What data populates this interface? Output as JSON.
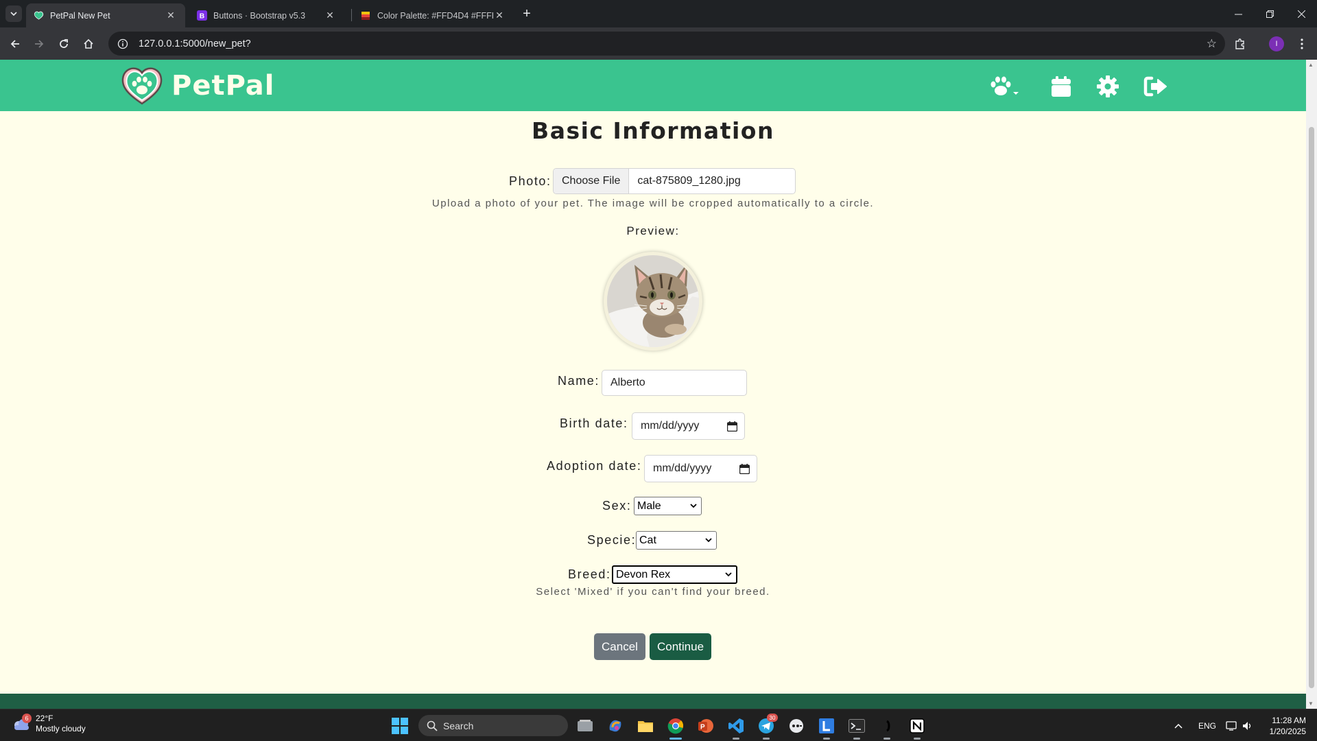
{
  "browser": {
    "tabs": [
      {
        "title": "PetPal New Pet",
        "active": true
      },
      {
        "title": "Buttons · Bootstrap v5.3",
        "active": false
      },
      {
        "title": "Color Palette: #FFD4D4 #FFFFE",
        "active": false
      }
    ],
    "url": "127.0.0.1:5000/new_pet?",
    "profile_initial": "I"
  },
  "navbar": {
    "brand": "PetPal",
    "icons": [
      "paw-menu-icon",
      "calendar-icon",
      "gear-icon",
      "logout-icon"
    ],
    "color": "#3ac48f"
  },
  "form": {
    "heading": "Basic Information",
    "photo": {
      "label": "Photo:",
      "button_label": "Choose File",
      "file_name": "cat-875809_1280.jpg",
      "help": "Upload a photo of your pet. The image will be cropped automatically to a circle."
    },
    "preview_label": "Preview:",
    "name": {
      "label": "Name:",
      "value": "Alberto"
    },
    "birth_date": {
      "label": "Birth date:",
      "placeholder": "mm/dd/yyyy"
    },
    "adoption_date": {
      "label": "Adoption date:",
      "placeholder": "mm/dd/yyyy"
    },
    "sex": {
      "label": "Sex:",
      "value": "Male"
    },
    "specie": {
      "label": "Specie:",
      "value": "Cat"
    },
    "breed": {
      "label": "Breed:",
      "value": "Devon Rex",
      "help": "Select 'Mixed' if you can't find your breed."
    },
    "cancel_label": "Cancel",
    "continue_label": "Continue"
  },
  "taskbar": {
    "weather_temp": "22°F",
    "weather_desc": "Mostly cloudy",
    "weather_badge": "6",
    "search_placeholder": "Search",
    "telegram_badge": "30",
    "language": "ENG",
    "time": "11:28 AM",
    "date": "1/20/2025"
  }
}
